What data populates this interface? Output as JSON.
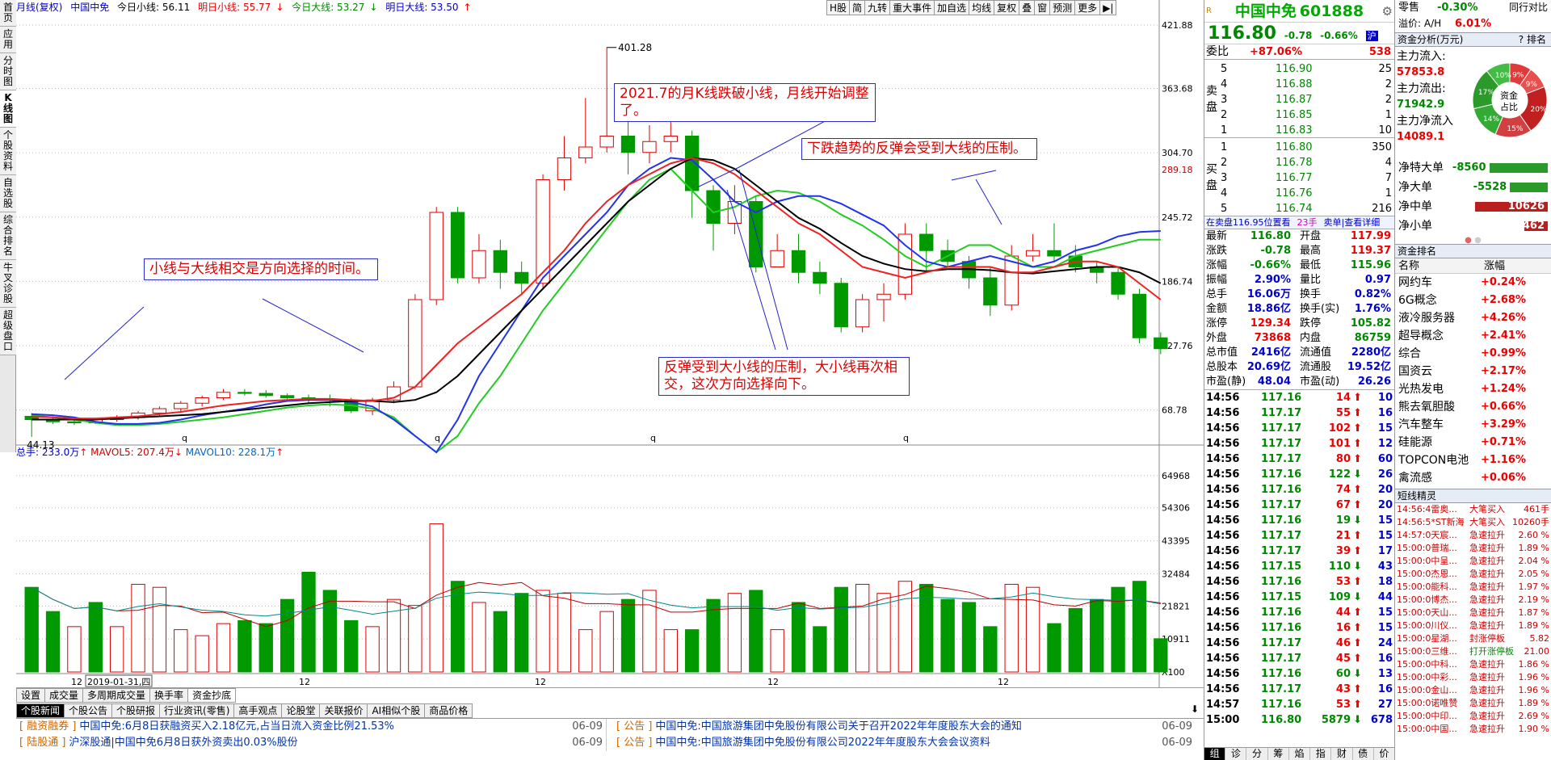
{
  "left_tabs": [
    "首页",
    "应用",
    "分时图",
    "K线图",
    "个股资料",
    "自选股",
    "综合排名",
    "牛叉诊股",
    "超级盘口"
  ],
  "header": {
    "period": "月线(复权)",
    "stock": "中国中免",
    "today_small": "今日小线: 56.11",
    "tomorrow_small": "明日小线: 55.77",
    "today_big": "今日大线: 53.27",
    "tomorrow_big": "明日大线: 53.50"
  },
  "toolbar": [
    "H股",
    "简",
    "九转",
    "重大事件",
    "加自选",
    "均线",
    "复权",
    "叠",
    "窗",
    "预测",
    "更多"
  ],
  "price_axis": [
    "421.88",
    "363.68",
    "304.70",
    "289.18",
    "245.72",
    "186.74",
    "127.76",
    "68.78"
  ],
  "vol_axis": [
    "64968",
    "54306",
    "43395",
    "32484",
    "21821",
    "10911",
    "X100"
  ],
  "x_labels": [
    "12",
    "2019-01-31,四",
    "12",
    "12",
    "12",
    "12"
  ],
  "vol_header": {
    "total": "总手: 233.0万",
    "mavol5": "MAVOL5: 207.4万",
    "mavol10": "MAVOL10: 228.1万"
  },
  "marks": {
    "high": "401.28",
    "low": "44.13"
  },
  "annotations": {
    "a1": "小线与大线相交是方向选择的时间。",
    "a2": "2021.7的月K线跌破小线，月线开始调整了。",
    "a3": "下跌趋势的反弹会受到大线的压制。",
    "a4": "反弹受到大小线的压制，大小线再次相交，这次方向选择向下。"
  },
  "chart_data": {
    "type": "candlestick",
    "candles": [
      [
        63,
        60,
        66,
        44.13
      ],
      [
        60,
        58,
        63,
        56
      ],
      [
        58,
        57,
        60,
        55
      ],
      [
        57,
        60,
        61,
        56
      ],
      [
        60,
        62,
        64,
        58
      ],
      [
        62,
        66,
        68,
        60
      ],
      [
        66,
        70,
        72,
        63
      ],
      [
        70,
        75,
        77,
        67
      ],
      [
        75,
        80,
        82,
        72
      ],
      [
        80,
        85,
        88,
        78
      ],
      [
        85,
        84,
        88,
        82
      ],
      [
        84,
        82,
        87,
        80
      ],
      [
        82,
        80,
        84,
        78
      ],
      [
        80,
        79,
        83,
        75
      ],
      [
        79,
        78,
        83,
        72
      ],
      [
        78,
        68,
        80,
        66
      ],
      [
        68,
        78,
        80,
        64
      ],
      [
        78,
        90,
        95,
        75
      ],
      [
        90,
        170,
        175,
        88
      ],
      [
        170,
        250,
        255,
        165
      ],
      [
        250,
        190,
        255,
        185
      ],
      [
        190,
        215,
        230,
        185
      ],
      [
        215,
        195,
        225,
        180
      ],
      [
        195,
        185,
        205,
        175
      ],
      [
        185,
        280,
        285,
        180
      ],
      [
        280,
        300,
        320,
        270
      ],
      [
        300,
        310,
        355,
        295
      ],
      [
        310,
        320,
        401.28,
        305
      ],
      [
        320,
        305,
        335,
        285
      ],
      [
        305,
        315,
        330,
        295
      ],
      [
        315,
        320,
        350,
        305
      ],
      [
        320,
        270,
        325,
        245
      ],
      [
        270,
        240,
        275,
        215
      ],
      [
        240,
        260,
        275,
        230
      ],
      [
        260,
        200,
        265,
        195
      ],
      [
        200,
        215,
        230,
        200
      ],
      [
        215,
        195,
        230,
        185
      ],
      [
        195,
        185,
        205,
        175
      ],
      [
        185,
        145,
        190,
        140
      ],
      [
        145,
        170,
        175,
        140
      ],
      [
        170,
        175,
        185,
        150
      ],
      [
        175,
        230,
        240,
        170
      ],
      [
        230,
        215,
        240,
        195
      ],
      [
        215,
        205,
        225,
        200
      ],
      [
        205,
        190,
        210,
        180
      ],
      [
        190,
        165,
        200,
        155
      ],
      [
        165,
        210,
        220,
        160
      ],
      [
        210,
        215,
        230,
        205
      ],
      [
        215,
        210,
        240,
        205
      ],
      [
        210,
        200,
        220,
        195
      ],
      [
        200,
        195,
        205,
        185
      ],
      [
        195,
        175,
        200,
        170
      ],
      [
        175,
        135,
        180,
        130
      ],
      [
        135,
        125,
        140,
        120
      ]
    ],
    "ma_small": [
      63,
      62,
      61,
      61,
      62,
      63,
      65,
      67,
      70,
      73,
      75,
      77,
      78,
      79,
      79,
      78,
      77,
      80,
      90,
      110,
      130,
      145,
      160,
      175,
      195,
      215,
      240,
      260,
      275,
      285,
      295,
      300,
      295,
      285,
      270,
      255,
      240,
      230,
      215,
      200,
      195,
      190,
      195,
      200,
      200,
      200,
      195,
      195,
      200,
      205,
      205,
      200,
      185,
      170
    ],
    "ma_big": [
      60,
      60,
      60,
      60,
      61,
      62,
      63,
      64,
      65,
      67,
      69,
      71,
      73,
      75,
      76,
      77,
      77,
      76,
      78,
      85,
      100,
      120,
      140,
      160,
      180,
      200,
      220,
      240,
      260,
      275,
      290,
      300,
      298,
      290,
      275,
      260,
      245,
      235,
      222,
      210,
      203,
      198,
      196,
      198,
      198,
      197,
      195,
      194,
      196,
      198,
      200,
      200,
      195,
      185
    ],
    "blue_line": [
      65,
      64,
      62,
      58,
      56,
      56,
      57,
      60,
      64,
      67,
      70,
      74,
      77,
      78,
      78,
      76,
      72,
      60,
      45,
      30,
      60,
      100,
      130,
      160,
      190,
      210,
      230,
      250,
      275,
      290,
      300,
      298,
      280,
      260,
      250,
      260,
      265,
      265,
      258,
      248,
      238,
      220,
      205,
      200,
      205,
      210,
      205,
      200,
      205,
      215,
      220,
      228,
      232,
      233
    ],
    "green_line": [
      64,
      62,
      60,
      57,
      55,
      55,
      56,
      58,
      60,
      62,
      65,
      68,
      71,
      73,
      74,
      73,
      70,
      62,
      45,
      30,
      45,
      75,
      100,
      130,
      160,
      185,
      210,
      235,
      260,
      280,
      290,
      270,
      250,
      255,
      265,
      270,
      268,
      260,
      248,
      238,
      225,
      210,
      200,
      210,
      220,
      220,
      210,
      200,
      200,
      210,
      215,
      220,
      225,
      225
    ],
    "volumes": [
      28,
      20,
      15,
      23,
      15,
      29,
      28,
      14,
      12,
      16,
      17,
      16,
      24,
      33,
      27,
      17,
      15,
      24,
      22,
      49,
      30,
      23,
      20,
      26,
      27,
      26,
      14,
      20,
      24,
      27,
      14,
      14,
      24,
      26,
      27,
      14,
      23,
      15,
      28,
      29,
      26,
      30,
      29,
      24,
      23,
      15,
      29,
      28,
      16,
      21,
      24,
      28,
      30,
      11
    ],
    "vol_up": [
      0,
      0,
      1,
      0,
      1,
      1,
      1,
      1,
      1,
      1,
      0,
      0,
      0,
      0,
      0,
      0,
      1,
      1,
      1,
      1,
      0,
      1,
      0,
      0,
      1,
      1,
      1,
      1,
      0,
      1,
      1,
      0,
      0,
      1,
      0,
      1,
      0,
      0,
      0,
      1,
      1,
      1,
      0,
      0,
      0,
      0,
      1,
      1,
      0,
      0,
      0,
      0,
      0,
      0
    ],
    "ylim": [
      30,
      430
    ],
    "vol_ylim": [
      0,
      70
    ]
  },
  "quote": {
    "name": "中国中免",
    "code": "601888",
    "price": "116.80",
    "chg": "-0.78",
    "pct": "-0.66%",
    "flag": "沪",
    "weibi_label": "委比",
    "weibi": "+87.06%",
    "weicha": "538",
    "sells": [
      [
        "5",
        "116.90",
        "25"
      ],
      [
        "4",
        "116.88",
        "2"
      ],
      [
        "3",
        "116.87",
        "2"
      ],
      [
        "2",
        "116.85",
        "1"
      ],
      [
        "1",
        "116.83",
        "10"
      ]
    ],
    "buys": [
      [
        "1",
        "116.80",
        "350"
      ],
      [
        "2",
        "116.78",
        "4"
      ],
      [
        "3",
        "116.77",
        "7"
      ],
      [
        "4",
        "116.76",
        "1"
      ],
      [
        "5",
        "116.74",
        "216"
      ]
    ],
    "sell_label": "卖盘",
    "buy_label": "买盘",
    "depth_line": [
      "在卖盘116.95位置看",
      "23手",
      "卖单|查看详细"
    ],
    "stats": [
      [
        "最新",
        "116.80",
        "开盘",
        "117.99"
      ],
      [
        "涨跌",
        "-0.78",
        "最高",
        "119.37"
      ],
      [
        "涨幅",
        "-0.66%",
        "最低",
        "115.96"
      ],
      [
        "振幅",
        "2.90%",
        "量比",
        "0.97"
      ],
      [
        "总手",
        "16.06万",
        "换手",
        "0.82%"
      ],
      [
        "金额",
        "18.86亿",
        "换手(实)",
        "1.76%"
      ],
      [
        "涨停",
        "129.34",
        "跌停",
        "105.82"
      ],
      [
        "外盘",
        "73868",
        "内盘",
        "86759"
      ],
      [
        "总市值",
        "2416亿",
        "流通值",
        "2280亿"
      ],
      [
        "总股本",
        "20.69亿",
        "流通股",
        "19.52亿"
      ],
      [
        "市盈(静)",
        "48.04",
        "市盈(动)",
        "26.26"
      ]
    ],
    "ticks": [
      [
        "14:56",
        "117.16",
        "14",
        "10"
      ],
      [
        "14:56",
        "117.17",
        "55",
        "16"
      ],
      [
        "14:56",
        "117.17",
        "102",
        "15"
      ],
      [
        "14:56",
        "117.17",
        "101",
        "12"
      ],
      [
        "14:56",
        "117.17",
        "80",
        "60"
      ],
      [
        "14:56",
        "117.16",
        "122",
        "26"
      ],
      [
        "14:56",
        "117.16",
        "74",
        "20"
      ],
      [
        "14:56",
        "117.17",
        "67",
        "20"
      ],
      [
        "14:56",
        "117.16",
        "19",
        "15"
      ],
      [
        "14:56",
        "117.17",
        "21",
        "15"
      ],
      [
        "14:56",
        "117.17",
        "39",
        "17"
      ],
      [
        "14:56",
        "117.15",
        "110",
        "43"
      ],
      [
        "14:56",
        "117.16",
        "53",
        "18"
      ],
      [
        "14:56",
        "117.15",
        "109",
        "44"
      ],
      [
        "14:56",
        "117.16",
        "44",
        "15"
      ],
      [
        "14:56",
        "117.16",
        "16",
        "15"
      ],
      [
        "14:56",
        "117.17",
        "46",
        "24"
      ],
      [
        "14:56",
        "117.17",
        "45",
        "16"
      ],
      [
        "14:56",
        "117.16",
        "60",
        "13"
      ],
      [
        "14:56",
        "117.17",
        "43",
        "16"
      ],
      [
        "14:57",
        "117.16",
        "53",
        "27"
      ],
      [
        "15:00",
        "116.80",
        "5879",
        "678"
      ]
    ],
    "tick_up": [
      1,
      1,
      1,
      1,
      1,
      0,
      1,
      1,
      0,
      1,
      1,
      0,
      1,
      0,
      1,
      1,
      1,
      1,
      0,
      1,
      1,
      0
    ],
    "bottom_tabs": [
      "组",
      "诊",
      "分",
      "筹",
      "焰",
      "指",
      "财",
      "债",
      "价"
    ]
  },
  "right2": {
    "header": {
      "l1": "零售",
      "l1v": "-0.30%",
      "r1": "同行对比",
      "l2": "溢价: A/H",
      "l2v": "6.01%"
    },
    "capital_title": "资金分析(万元)",
    "capital_tab": "排名",
    "flows": [
      [
        "主力流入:",
        "57853.8"
      ],
      [
        "主力流出:",
        "71942.9"
      ],
      [
        "主力净流入",
        "14089.1"
      ]
    ],
    "donut_center": "资金占比",
    "donut_labels": [
      "9%",
      "9%",
      "10%",
      "20%",
      "17%",
      "14%",
      "15%"
    ],
    "net": [
      [
        "净特大单",
        "-8560"
      ],
      [
        "净大单",
        "-5528"
      ],
      [
        "净中单",
        "10626"
      ],
      [
        "净小单",
        "3462"
      ]
    ],
    "rank_title": "资金排名",
    "rank_head": [
      "名称",
      "涨幅"
    ],
    "ranks": [
      [
        "网约车",
        "+0.24%"
      ],
      [
        "6G概念",
        "+2.68%"
      ],
      [
        "液冷服务器",
        "+4.26%"
      ],
      [
        "超导概念",
        "+2.41%"
      ],
      [
        "综合",
        "+0.99%"
      ],
      [
        "国资云",
        "+2.17%"
      ],
      [
        "光热发电",
        "+1.24%"
      ],
      [
        "熊去氧胆酸",
        "+0.66%"
      ],
      [
        "汽车整车",
        "+3.29%"
      ],
      [
        "硅能源",
        "+0.71%"
      ],
      [
        "TOPCON电池",
        "+1.16%"
      ],
      [
        "禽流感",
        "+0.06%"
      ]
    ],
    "elf_title": "短线精灵",
    "elf": [
      [
        "14:56:4",
        "雷奥...",
        "大笔买入",
        "461手"
      ],
      [
        "14:56:5",
        "*ST新海",
        "大笔买入",
        "10260手"
      ],
      [
        "14:57:0",
        "天宸...",
        "急速拉升",
        "2.60 %"
      ],
      [
        "15:00:0",
        "普瑞...",
        "急速拉升",
        "1.89 %"
      ],
      [
        "15:00:0",
        "中呈...",
        "急速拉升",
        "2.04 %"
      ],
      [
        "15:00:0",
        "杰恩...",
        "急速拉升",
        "2.05 %"
      ],
      [
        "15:00:0",
        "能科...",
        "急速拉升",
        "1.97 %"
      ],
      [
        "15:00:0",
        "博杰...",
        "急速拉升",
        "2.19 %"
      ],
      [
        "15:00:0",
        "天山...",
        "急速拉升",
        "1.87 %"
      ],
      [
        "15:00:0",
        "川仪...",
        "急速拉升",
        "1.89 %"
      ],
      [
        "15:00:0",
        "星湖...",
        "封涨停板",
        "5.82"
      ],
      [
        "15:00:0",
        "三维...",
        "打开涨停板",
        "21.00"
      ],
      [
        "15:00:0",
        "中科...",
        "急速拉升",
        "1.86 %"
      ],
      [
        "15:00:0",
        "中彩...",
        "急速拉升",
        "1.96 %"
      ],
      [
        "15:00:0",
        "金山...",
        "急速拉升",
        "1.96 %"
      ],
      [
        "15:00:0",
        "诺唯赞",
        "急速拉升",
        "1.89 %"
      ],
      [
        "15:00:0",
        "中印...",
        "急速拉升",
        "2.69 %"
      ],
      [
        "15:00:0",
        "中国...",
        "急速拉升",
        "1.90 %"
      ]
    ]
  },
  "bottom": {
    "tools": [
      "设置",
      "成交量",
      "多周期成交量",
      "换手率",
      "资金抄底"
    ],
    "tabs": [
      "个股新闻",
      "个股公告",
      "个股研报",
      "行业资讯(零售)",
      "高手观点",
      "论股堂",
      "关联报价",
      "AI相似个股",
      "商品价格"
    ],
    "news_left": [
      [
        "[ 融资融券 ]",
        "中国中免:6月8日获融资买入2.18亿元,占当日流入资金比例21.53%",
        "06-09"
      ],
      [
        "[ 陆股通 ]",
        "沪深股通|中国中免6月8日获外资卖出0.03%股份",
        "06-09"
      ]
    ],
    "news_right": [
      [
        "[ 公告 ]",
        "中国中免:中国旅游集团中免股份有限公司关于召开2022年年度股东大会的通知",
        "06-09"
      ],
      [
        "[ 公告 ]",
        "中国中免:中国旅游集团中免股份有限公司2022年年度股东大会会议资料",
        "06-09"
      ]
    ]
  }
}
